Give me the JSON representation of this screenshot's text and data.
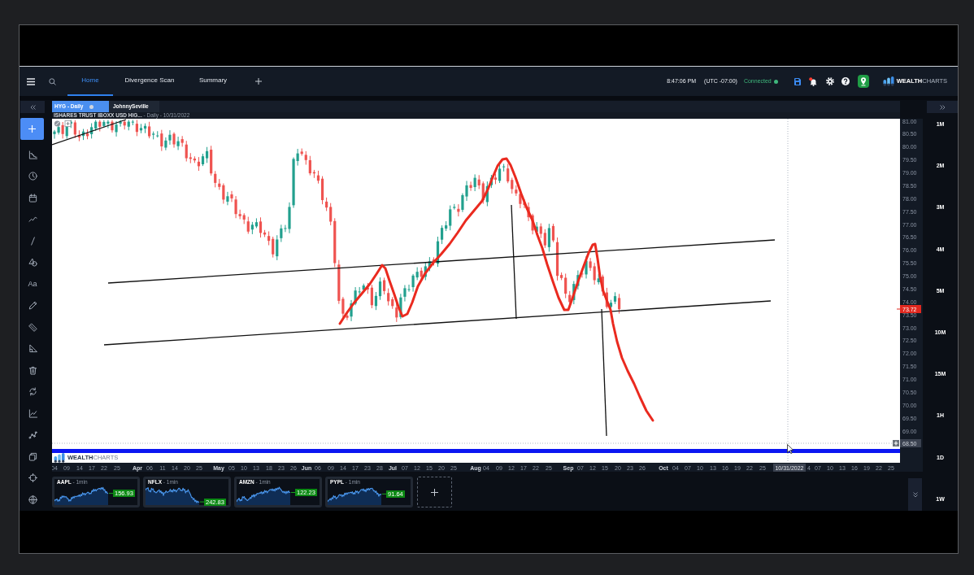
{
  "nav": {
    "tabs": [
      {
        "label": "Home",
        "selected": true
      },
      {
        "label": "Divergence Scan",
        "selected": false
      },
      {
        "label": "Summary",
        "selected": false
      }
    ],
    "time": "8:47:06 PM",
    "timezone": "(UTC -07:00)",
    "connection": {
      "label": "Connected",
      "connected": true
    },
    "alerts": {
      "unread": true
    },
    "logo": "**WEALTH**CHARTS"
  },
  "chart_tabs": [
    {
      "label": "HYG - Daily",
      "selected": true
    },
    {
      "label": "JohnnySeville",
      "selected": false
    }
  ],
  "toolbar": {
    "text_tool": "Aa"
  },
  "chart": {
    "title": "**ISHARES TRUST IBOXX USD HIG...** - Daily - 10/31/2022",
    "price_labels": [
      "81.00",
      "80.50",
      "80.00",
      "79.50",
      "79.00",
      "78.50",
      "78.00",
      "77.50",
      "77.00",
      "76.50",
      "76.00",
      "75.50",
      "75.00",
      "74.50",
      "74.00",
      "73.50",
      "73.00",
      "72.50",
      "72.00",
      "71.50",
      "71.00",
      "70.50",
      "70.00",
      "69.50",
      "69.00"
    ],
    "last_price": "73.72",
    "crosshair_price": "68.50",
    "crosshair_date": "10/31/2022",
    "date_labels": [
      {
        "text": "04",
        "kind": "day"
      },
      {
        "text": "09",
        "kind": "day"
      },
      {
        "text": "14",
        "kind": "day"
      },
      {
        "text": "17",
        "kind": "day"
      },
      {
        "text": "22",
        "kind": "day"
      },
      {
        "text": "25",
        "kind": "day"
      },
      {
        "text": "Apr",
        "kind": "month"
      },
      {
        "text": "06",
        "kind": "day"
      },
      {
        "text": "11",
        "kind": "day"
      },
      {
        "text": "14",
        "kind": "day"
      },
      {
        "text": "20",
        "kind": "day"
      },
      {
        "text": "25",
        "kind": "day"
      },
      {
        "text": "May",
        "kind": "month"
      },
      {
        "text": "05",
        "kind": "day"
      },
      {
        "text": "10",
        "kind": "day"
      },
      {
        "text": "13",
        "kind": "day"
      },
      {
        "text": "18",
        "kind": "day"
      },
      {
        "text": "23",
        "kind": "day"
      },
      {
        "text": "26",
        "kind": "day"
      },
      {
        "text": "Jun",
        "kind": "month"
      },
      {
        "text": "06",
        "kind": "day"
      },
      {
        "text": "09",
        "kind": "day"
      },
      {
        "text": "14",
        "kind": "day"
      },
      {
        "text": "17",
        "kind": "day"
      },
      {
        "text": "23",
        "kind": "day"
      },
      {
        "text": "28",
        "kind": "day"
      },
      {
        "text": "Jul",
        "kind": "month"
      },
      {
        "text": "07",
        "kind": "day"
      },
      {
        "text": "12",
        "kind": "day"
      },
      {
        "text": "15",
        "kind": "day"
      },
      {
        "text": "20",
        "kind": "day"
      },
      {
        "text": "25",
        "kind": "day"
      },
      {
        "text": "Aug",
        "kind": "month"
      },
      {
        "text": "04",
        "kind": "day"
      },
      {
        "text": "09",
        "kind": "day"
      },
      {
        "text": "12",
        "kind": "day"
      },
      {
        "text": "17",
        "kind": "day"
      },
      {
        "text": "22",
        "kind": "day"
      },
      {
        "text": "25",
        "kind": "day"
      },
      {
        "text": "Sep",
        "kind": "month"
      },
      {
        "text": "07",
        "kind": "day"
      },
      {
        "text": "12",
        "kind": "day"
      },
      {
        "text": "15",
        "kind": "day"
      },
      {
        "text": "20",
        "kind": "day"
      },
      {
        "text": "23",
        "kind": "day"
      },
      {
        "text": "26",
        "kind": "day"
      },
      {
        "text": "Oct",
        "kind": "month"
      },
      {
        "text": "04",
        "kind": "day"
      },
      {
        "text": "07",
        "kind": "day"
      },
      {
        "text": "10",
        "kind": "day"
      },
      {
        "text": "13",
        "kind": "day"
      },
      {
        "text": "16",
        "kind": "day"
      },
      {
        "text": "19",
        "kind": "day"
      },
      {
        "text": "22",
        "kind": "day"
      },
      {
        "text": "25",
        "kind": "day"
      },
      {
        "text": "4",
        "kind": "day"
      },
      {
        "text": "07",
        "kind": "day"
      },
      {
        "text": "10",
        "kind": "day"
      },
      {
        "text": "13",
        "kind": "day"
      },
      {
        "text": "16",
        "kind": "day"
      },
      {
        "text": "19",
        "kind": "day"
      },
      {
        "text": "22",
        "kind": "day"
      },
      {
        "text": "25",
        "kind": "day"
      }
    ],
    "watermark": "**WEALTH**CHARTS"
  },
  "tickers": [
    {
      "title": "**AAPL** - 1min",
      "price": "156.93"
    },
    {
      "title": "**NFLX** - 1min",
      "price": "242.83"
    },
    {
      "title": "**AMZN** - 1min",
      "price": "122.23"
    },
    {
      "title": "**PYPL** - 1min",
      "price": "91.64"
    }
  ],
  "timeframes": [
    {
      "label": "1M",
      "selected": false
    },
    {
      "label": "2M",
      "selected": false
    },
    {
      "label": "3M",
      "selected": false
    },
    {
      "label": "4M",
      "selected": false
    },
    {
      "label": "5M",
      "selected": false
    },
    {
      "label": "10M",
      "selected": false
    },
    {
      "label": "15M",
      "selected": false
    },
    {
      "label": "1H",
      "selected": false
    },
    {
      "label": "1D",
      "selected": false
    },
    {
      "label": "1W",
      "selected": false
    }
  ]
}
